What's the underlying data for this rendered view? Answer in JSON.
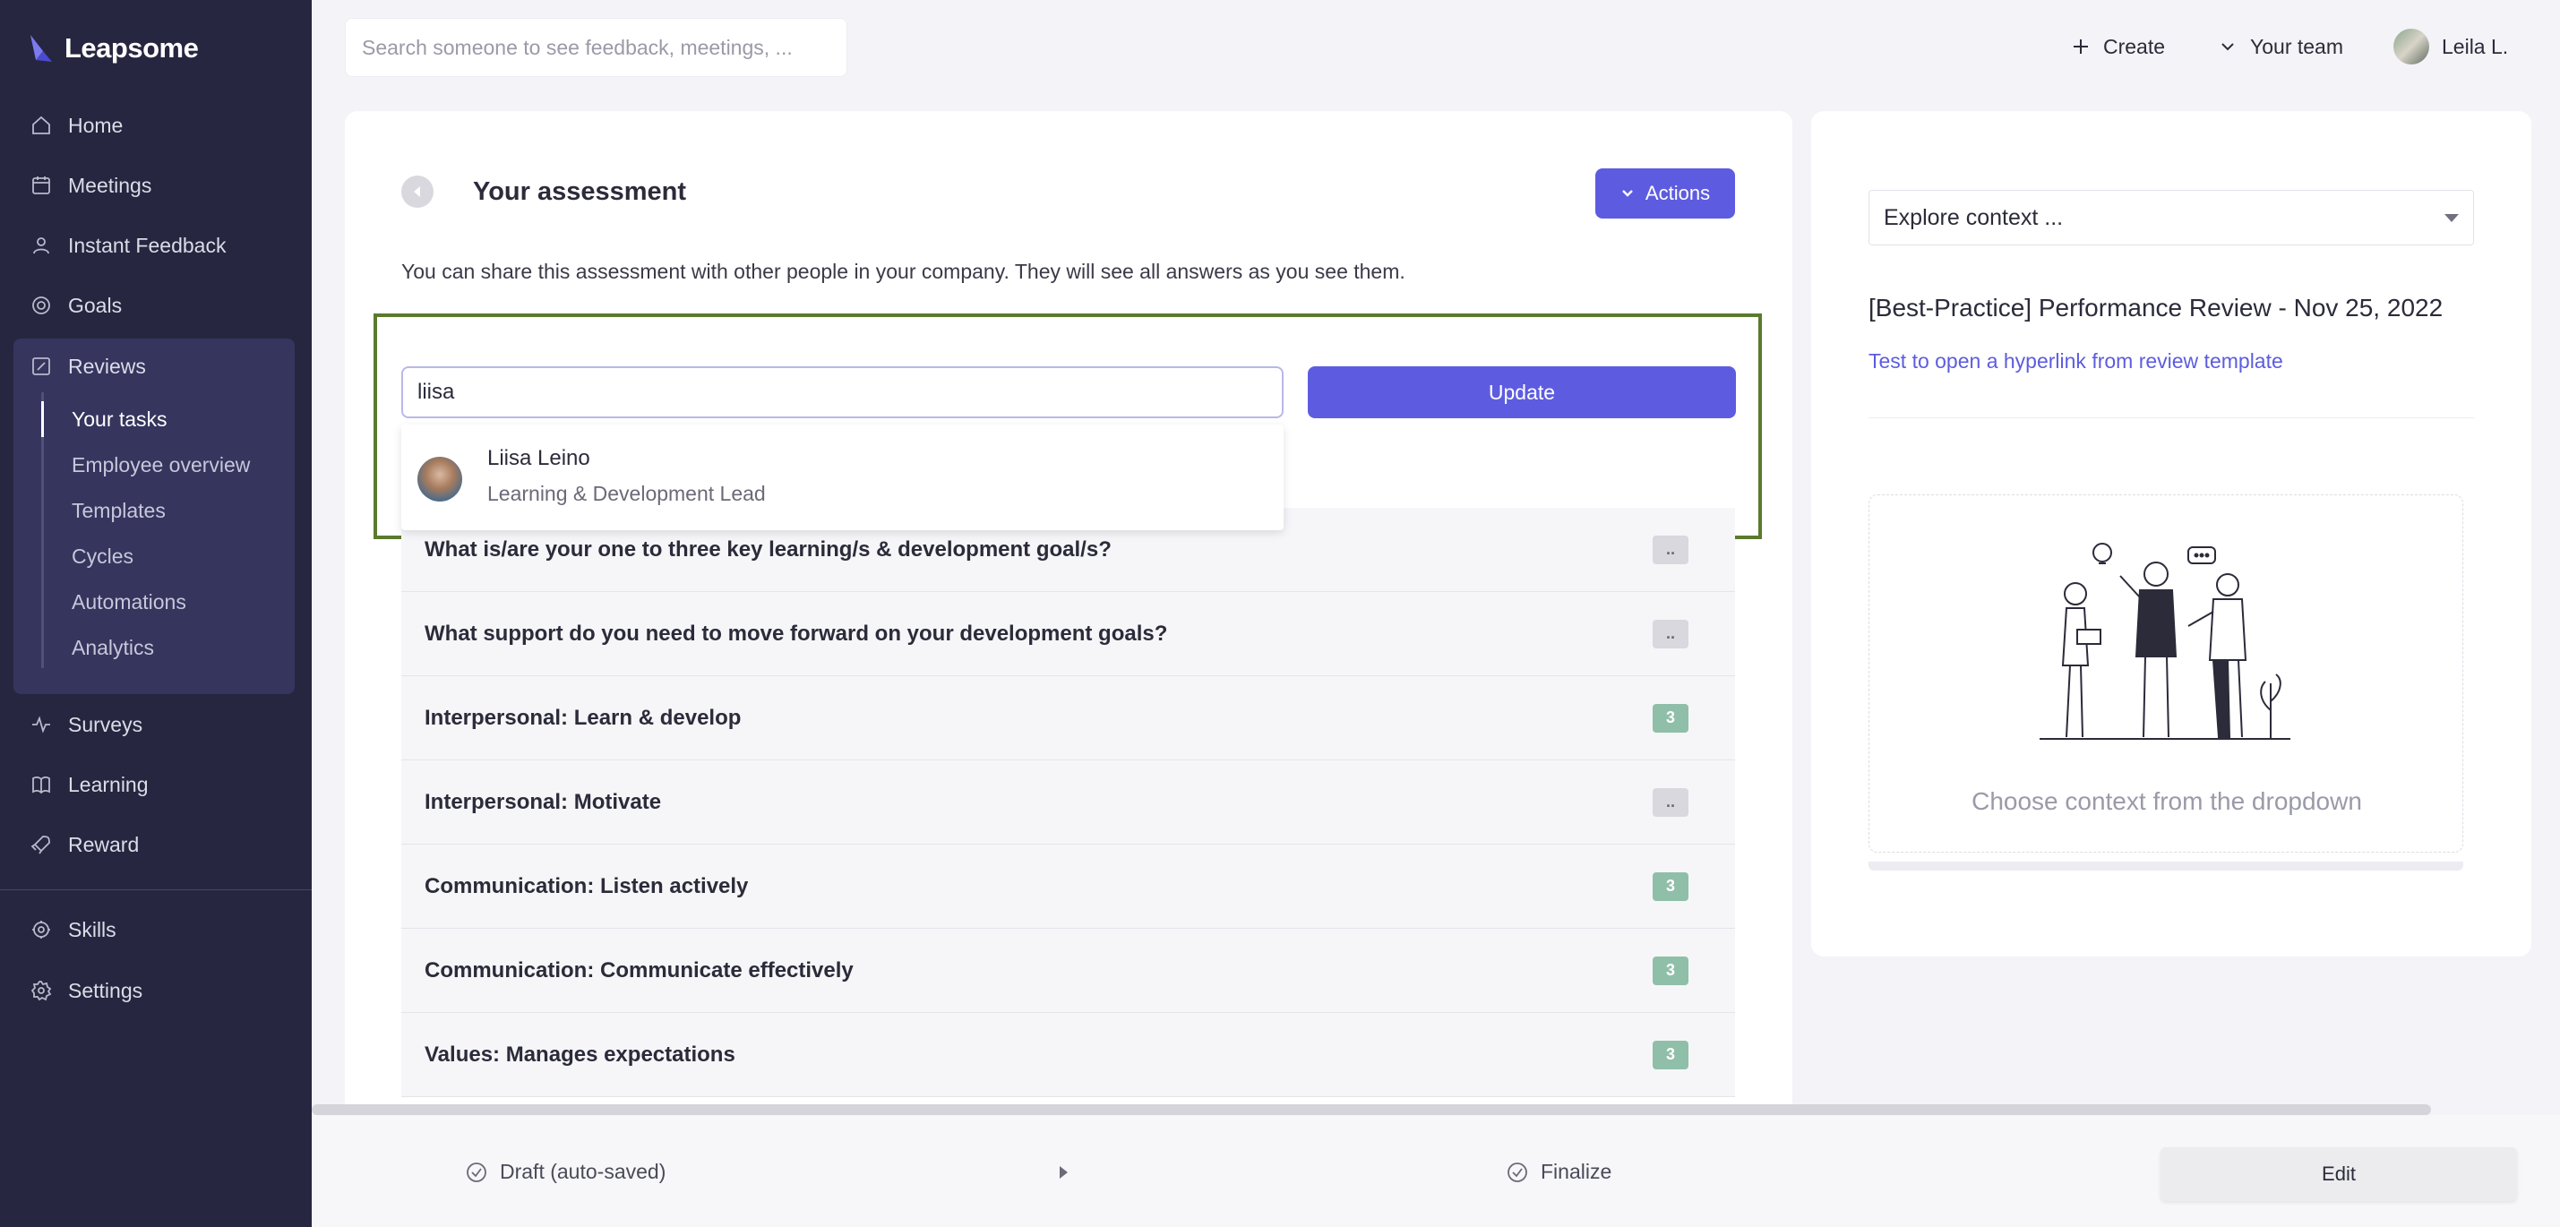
{
  "brand": {
    "name": "Leapsome",
    "accent": "#5d5ce0",
    "sidebar_bg": "#262640"
  },
  "sidebar": {
    "items": [
      {
        "label": "Home",
        "icon": "home-icon"
      },
      {
        "label": "Meetings",
        "icon": "calendar-icon"
      },
      {
        "label": "Instant Feedback",
        "icon": "feedback-icon"
      },
      {
        "label": "Goals",
        "icon": "target-icon"
      },
      {
        "label": "Reviews",
        "icon": "edit-icon"
      },
      {
        "label": "Surveys",
        "icon": "pulse-icon"
      },
      {
        "label": "Learning",
        "icon": "book-icon"
      },
      {
        "label": "Reward",
        "icon": "rocket-icon"
      },
      {
        "label": "Skills",
        "icon": "skills-icon"
      },
      {
        "label": "Settings",
        "icon": "gear-icon"
      }
    ],
    "reviews_sub": [
      "Your tasks",
      "Employee overview",
      "Templates",
      "Cycles",
      "Automations",
      "Analytics"
    ]
  },
  "topbar": {
    "search_placeholder": "Search someone to see feedback, meetings, ...",
    "create_label": "Create",
    "team_label": "Your team",
    "user_label": "Leila L."
  },
  "assessment": {
    "title": "Your assessment",
    "actions_label": "Actions",
    "share_text": "You can share this assessment with other people in your company. They will see all answers as you see them.",
    "input_value": "liisa",
    "update_label": "Update",
    "suggestion": {
      "name": "Liisa Leino",
      "role": "Learning & Development Lead"
    },
    "questions": [
      {
        "text": "What is/are your one to three key learning/s & development goal/s?",
        "badge": "..",
        "scored": false
      },
      {
        "text": "What support do you need to move forward on your development goals?",
        "badge": "..",
        "scored": false
      },
      {
        "text": "Interpersonal: Learn & develop",
        "badge": "3",
        "scored": true
      },
      {
        "text": "Interpersonal: Motivate",
        "badge": "..",
        "scored": false
      },
      {
        "text": "Communication: Listen actively",
        "badge": "3",
        "scored": true
      },
      {
        "text": "Communication: Communicate effectively",
        "badge": "3",
        "scored": true
      },
      {
        "text": "Values: Manages expectations",
        "badge": "3",
        "scored": true
      }
    ]
  },
  "context": {
    "select_value": "Explore context ...",
    "review_title": "[Best-Practice] Performance Review - Nov 25, 2022",
    "link_text": "Test to open a hyperlink from review template",
    "hint": "Choose context from the dropdown"
  },
  "footer": {
    "draft_label": "Draft (auto-saved)",
    "finalize_label": "Finalize",
    "edit_label": "Edit"
  }
}
